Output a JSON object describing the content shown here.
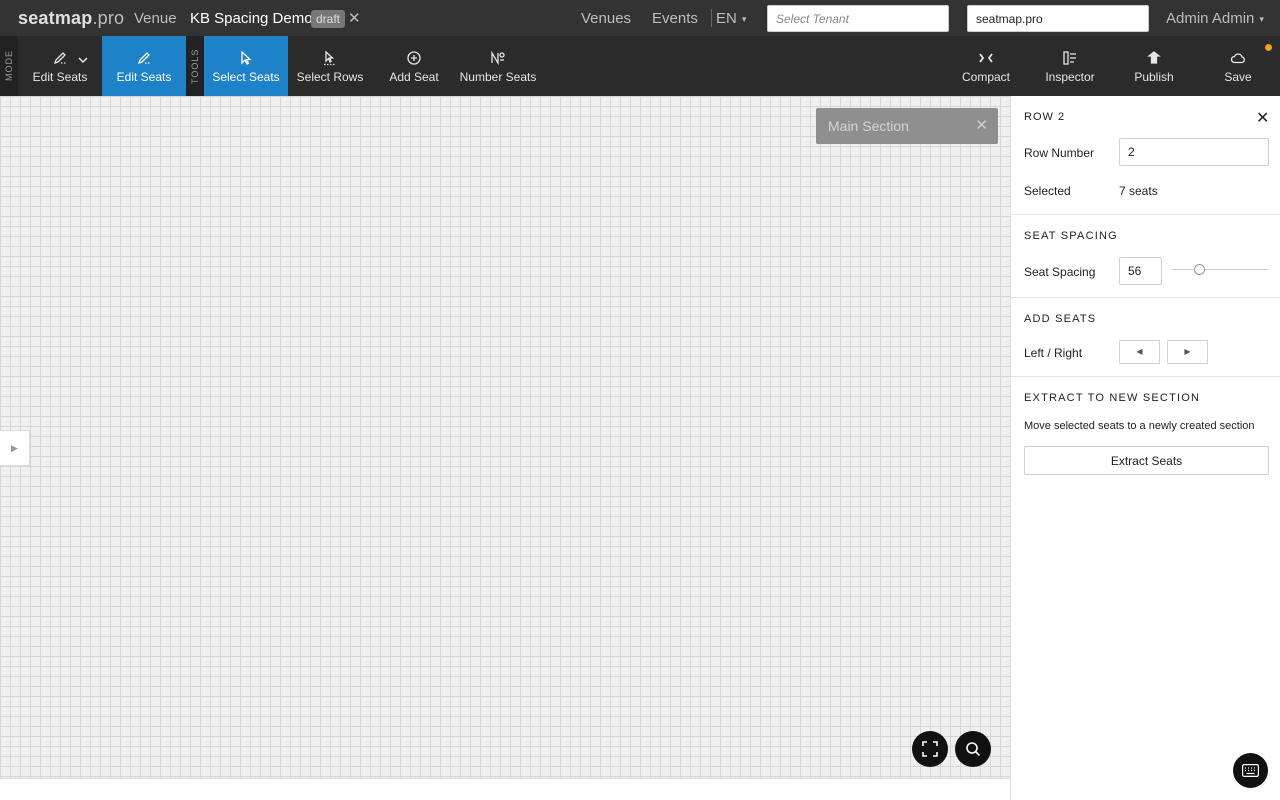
{
  "header": {
    "logo": {
      "brand": "seatmap",
      "suffix": ".pro"
    },
    "venue_link": "Venue",
    "project_title": "KB Spacing Demo",
    "status_badge": "draft",
    "close_symbol": "✕",
    "nav_venues": "Venues",
    "nav_events": "Events",
    "language": "EN",
    "tenant_placeholder": "Select Tenant",
    "domain_value": "seatmap.pro",
    "user_name": "Admin Admin"
  },
  "toolbar": {
    "mode_label": "MODE",
    "tools_label": "TOOLS",
    "mode_selector": {
      "label": "Edit Seats",
      "icon": "pen-icon"
    },
    "mode_active": {
      "label": "Edit Seats",
      "icon": "pen-icon"
    },
    "tools": [
      {
        "label": "Select Seats",
        "icon": "cursor-icon",
        "active": true
      },
      {
        "label": "Select Rows",
        "icon": "row-cursor-icon",
        "active": false
      },
      {
        "label": "Add Seat",
        "icon": "plus-circle-icon",
        "active": false
      },
      {
        "label": "Number Seats",
        "icon": "numero-icon",
        "active": false
      }
    ],
    "right_tools": [
      {
        "label": "Compact",
        "icon": "compact-icon"
      },
      {
        "label": "Inspector",
        "icon": "inspector-icon"
      },
      {
        "label": "Publish",
        "icon": "publish-icon"
      },
      {
        "label": "Save",
        "icon": "cloud-icon"
      }
    ],
    "accent_color": "#1e82c8",
    "unsaved_dot_color": "#f0a020"
  },
  "canvas": {
    "section_pill_label": "Main Section",
    "section_pill_close": "✕",
    "side_toggle_symbol": "▶"
  },
  "inspector": {
    "title": "ROW 2",
    "close_symbol": "✕",
    "row_number_label": "Row Number",
    "row_number_value": "2",
    "selected_label": "Selected",
    "selected_value": "7 seats",
    "seat_spacing_heading": "SEAT SPACING",
    "seat_spacing_label": "Seat Spacing",
    "seat_spacing_value": "56",
    "add_seats_heading": "ADD SEATS",
    "left_right_label": "Left / Right",
    "left_symbol": "◀",
    "right_symbol": "▶",
    "extract_heading": "EXTRACT TO NEW SECTION",
    "extract_desc": "Move selected seats to a newly created section",
    "extract_button": "Extract Seats"
  }
}
